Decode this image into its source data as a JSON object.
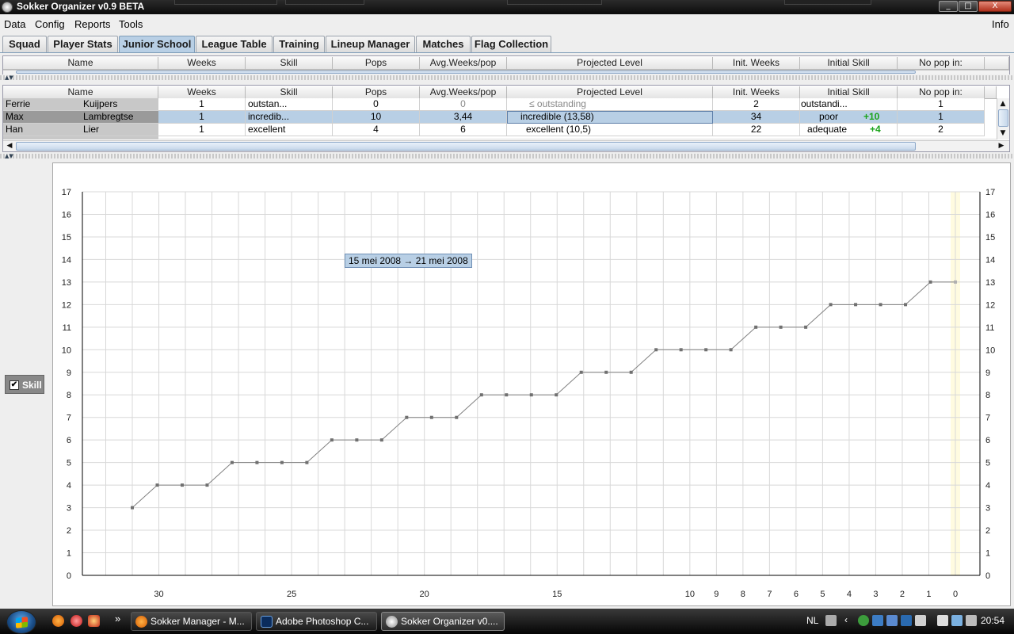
{
  "window": {
    "title": "Sokker Organizer v0.9 BETA",
    "controls": [
      "_",
      "□",
      "X"
    ]
  },
  "menu": {
    "items": [
      "Data",
      "Config",
      "Reports",
      "Tools"
    ],
    "right": "Info"
  },
  "tabs": [
    {
      "label": "Squad",
      "active": false
    },
    {
      "label": "Player Stats",
      "active": false
    },
    {
      "label": "Junior School",
      "active": true
    },
    {
      "label": "League Table",
      "active": false
    },
    {
      "label": "Training",
      "active": false
    },
    {
      "label": "Lineup Manager",
      "active": false
    },
    {
      "label": "Matches",
      "active": false
    },
    {
      "label": "Flag Collection",
      "active": false
    }
  ],
  "table": {
    "columns": [
      "Name",
      "Weeks",
      "Skill",
      "Pops",
      "Avg.Weeks/pop",
      "Projected Level",
      "Init. Weeks",
      "Initial Skill",
      "No pop in:"
    ],
    "rows": [
      {
        "first": "Ferrie",
        "last": "Kuijpers",
        "weeks": "1",
        "skill": "outstan...",
        "pops": "0",
        "avg": "0",
        "projected": "≤ outstanding",
        "init_weeks": "2",
        "initial_skill": "outstandi...",
        "bonus": "",
        "no_pop": "1",
        "selected": false
      },
      {
        "first": "Max",
        "last": "Lambregtse",
        "weeks": "1",
        "skill": "incredib...",
        "pops": "10",
        "avg": "3,44",
        "projected": "incredible (13,58)",
        "init_weeks": "34",
        "initial_skill": "poor",
        "bonus": "+10",
        "no_pop": "1",
        "selected": true
      },
      {
        "first": "Han",
        "last": "Lier",
        "weeks": "1",
        "skill": "excellent",
        "pops": "4",
        "avg": "6",
        "projected": "excellent (10,5)",
        "init_weeks": "22",
        "initial_skill": "adequate",
        "bonus": "+4",
        "no_pop": "2",
        "selected": false
      }
    ]
  },
  "legend": {
    "label": "Skill",
    "checked": true,
    "check_glyph": "✔"
  },
  "tooltip": {
    "text": "15 mei 2008 → 21 mei 2008"
  },
  "chart_data": {
    "type": "line",
    "x": [
      31,
      30,
      29,
      28,
      27,
      26,
      25,
      24,
      23,
      22,
      21,
      20,
      19,
      18,
      17,
      16,
      15,
      14,
      13,
      12,
      11,
      10,
      9,
      8,
      7,
      6,
      5,
      4,
      3,
      2,
      1,
      0
    ],
    "series": [
      {
        "values": [
          3,
          4,
          4,
          4,
          5,
          5,
          5,
          5,
          6,
          6,
          6,
          7,
          7,
          7,
          8,
          8,
          8,
          8,
          9,
          9,
          9,
          10,
          10,
          10,
          10,
          11,
          11,
          11,
          12,
          12,
          12,
          12,
          13,
          13
        ]
      }
    ],
    "x_all": [
      33,
      32,
      31,
      30,
      29,
      28,
      27,
      26,
      25,
      24,
      23,
      22,
      21,
      20,
      19,
      18,
      17,
      16,
      15,
      14,
      13,
      12,
      11,
      10,
      9,
      8,
      7,
      6,
      5,
      4,
      3,
      2,
      1,
      0
    ],
    "x_tick_labels": [
      "30",
      "25",
      "20",
      "15",
      "10",
      "9",
      "8",
      "7",
      "6",
      "5",
      "4",
      "3",
      "2",
      "1",
      "0"
    ],
    "x_tick_values": [
      30,
      25,
      20,
      15,
      10,
      9,
      8,
      7,
      6,
      5,
      4,
      3,
      2,
      1,
      0
    ],
    "ylim": [
      0,
      17
    ],
    "y_ticks": [
      0,
      1,
      2,
      3,
      4,
      5,
      6,
      7,
      8,
      9,
      10,
      11,
      12,
      13,
      14,
      15,
      16,
      17
    ],
    "grid": true,
    "line_color": "#808080",
    "highlight_x": 0,
    "highlight_color": "#fffbe0"
  },
  "taskbar": {
    "buttons": [
      {
        "label": "Sokker Manager - M...",
        "icon": "firefox-icon",
        "active": false
      },
      {
        "label": "Adobe Photoshop C...",
        "icon": "photoshop-icon",
        "active": false
      },
      {
        "label": "Sokker Organizer v0....",
        "icon": "sokker-icon",
        "active": true
      }
    ],
    "lang": "NL",
    "clock": "20:54",
    "quicklaunch_more": "»"
  }
}
